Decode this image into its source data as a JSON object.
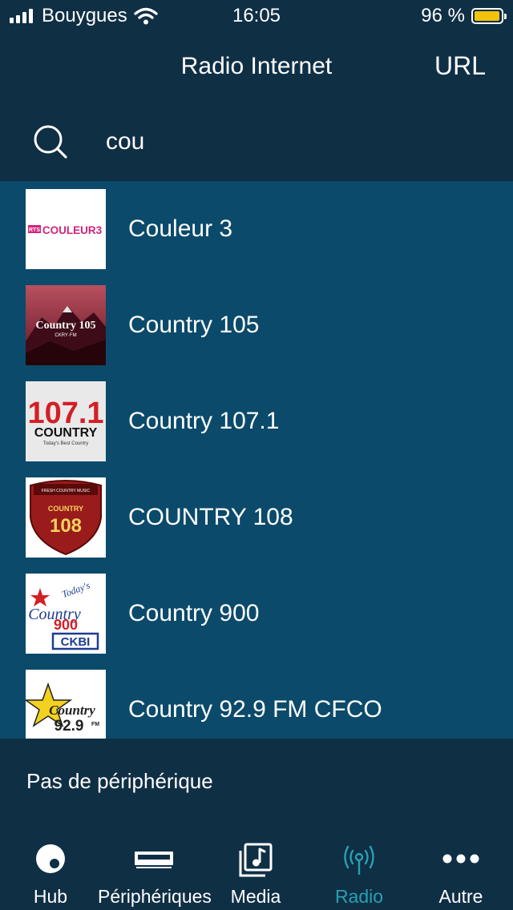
{
  "status_bar": {
    "carrier": "Bouygues",
    "time": "16:05",
    "battery": "96 %",
    "battery_level": 0.96,
    "battery_color": "#f2c20d"
  },
  "nav": {
    "title": "Radio Internet",
    "url_label": "URL"
  },
  "search": {
    "value": "cou"
  },
  "results": [
    {
      "label": "Couleur 3",
      "logo_text": "COULEUR3",
      "logo_sub": "RTS"
    },
    {
      "label": "Country 105",
      "logo_text": "Country 105",
      "logo_sub": "CKRY·FM"
    },
    {
      "label": "Country 107.1",
      "logo_text": "107.1",
      "logo_word": "COUNTRY",
      "logo_sub": "Today's Best Country"
    },
    {
      "label": "COUNTRY 108",
      "logo_text": "108",
      "logo_word": "COUNTRY",
      "logo_sub": "FRESH COUNTRY MUSIC"
    },
    {
      "label": "Country 900",
      "logo_text": "900",
      "logo_word": "Country",
      "logo_top": "Today's",
      "logo_sub": "CKBI"
    },
    {
      "label": "Country 92.9 FM CFCO",
      "logo_text": "92.9",
      "logo_word": "Country",
      "logo_sub": "FM"
    }
  ],
  "device_status": "Pas de périphérique",
  "tabs": [
    {
      "label": "Hub",
      "icon": "hub-icon",
      "active": false
    },
    {
      "label": "Périphériques",
      "icon": "devices-icon",
      "active": false
    },
    {
      "label": "Media",
      "icon": "media-icon",
      "active": false
    },
    {
      "label": "Radio",
      "icon": "radio-icon",
      "active": true
    },
    {
      "label": "Autre",
      "icon": "more-icon",
      "active": false
    }
  ],
  "colors": {
    "background": "#0f2f45",
    "list_background": "#0b4a6a",
    "accent": "#2a9fb2"
  }
}
